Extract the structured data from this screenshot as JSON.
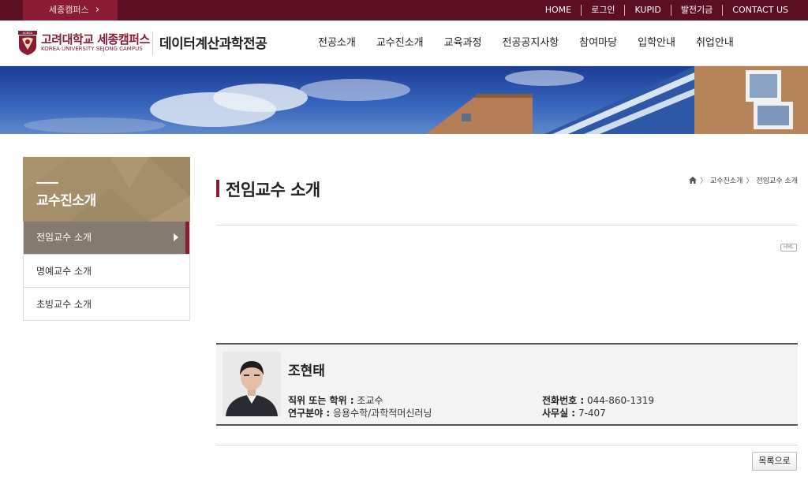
{
  "topbar": {
    "campus_button": "세종캠퍼스",
    "links": [
      "HOME",
      "로그인",
      "KUPID",
      "발전기금",
      "CONTACT US"
    ]
  },
  "header": {
    "univ_name": "고려대학교 세종캠퍼스",
    "univ_sub": "KOREA UNIVERSITY SEJONG CAMPUS",
    "logo_text": "KOREA",
    "dept_name": "데이터계산과학전공",
    "nav": [
      "전공소개",
      "교수진소개",
      "교육과정",
      "전공공지사항",
      "참여마당",
      "입학안내",
      "취업안내"
    ]
  },
  "sidebar": {
    "title": "교수진소개",
    "items": [
      {
        "label": "전임교수 소개",
        "active": true
      },
      {
        "label": "명예교수 소개",
        "active": false
      },
      {
        "label": "초빙교수 소개",
        "active": false
      }
    ]
  },
  "main": {
    "page_title": "전임교수 소개",
    "breadcrumb": [
      "교수진소개",
      "전임교수 소개"
    ],
    "badge": "HML",
    "professor": {
      "name": "조현태",
      "position_label": "직위 또는 학위 :",
      "position": "조교수",
      "field_label": "연구분야 :",
      "field": "응용수학/과학적머신러닝",
      "phone_label": "전화번호 :",
      "phone": "044-860-1319",
      "office_label": "사무실 :",
      "office": "7-407"
    },
    "list_button": "목록으로"
  },
  "colors": {
    "brand": "#8a1b33",
    "topbar": "#5c0f22",
    "sidebar_head": "#a48f6a",
    "sidebar_active": "#847a70"
  }
}
